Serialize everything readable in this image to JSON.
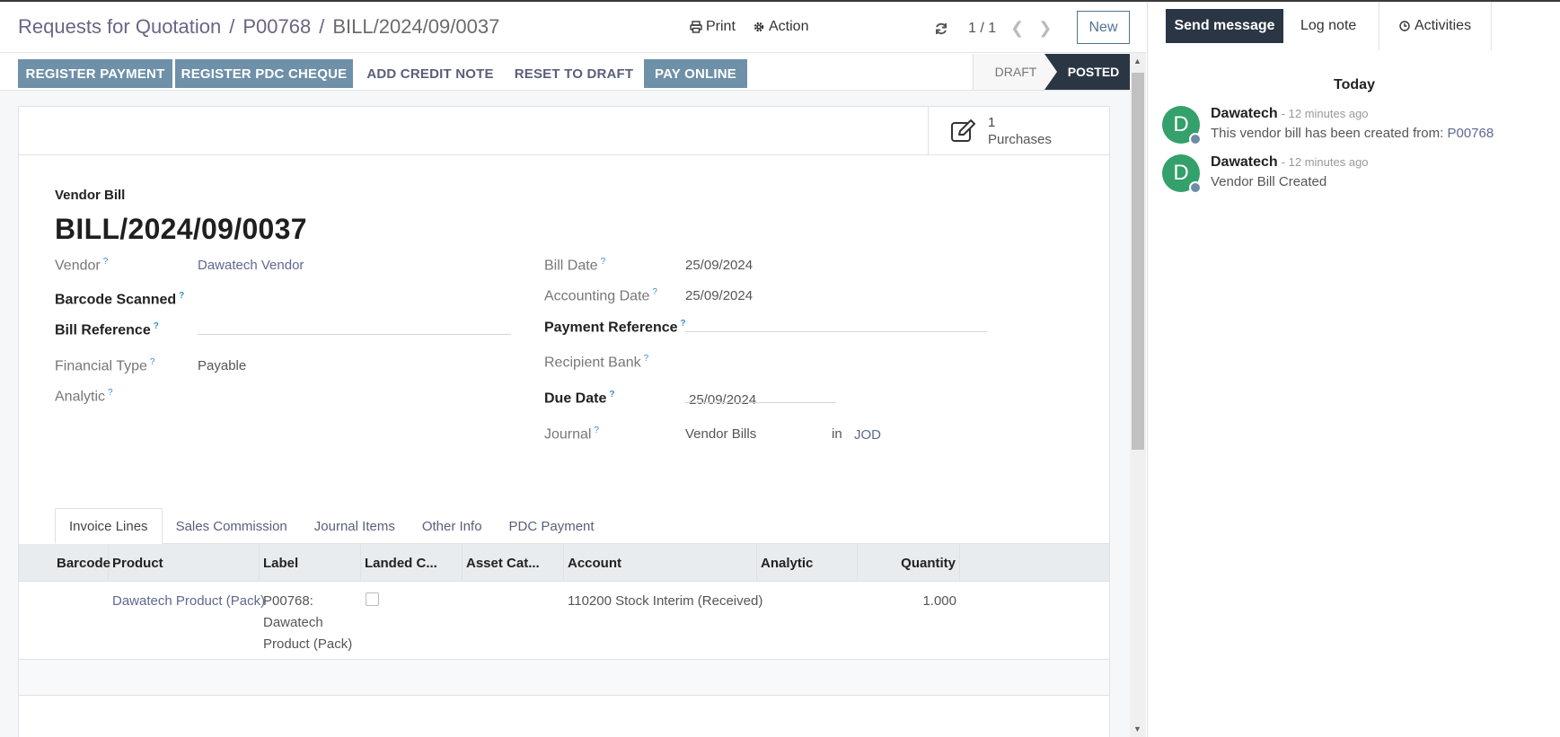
{
  "breadcrumb": {
    "items": [
      "Requests for Quotation",
      "P00768"
    ],
    "current": "BILL/2024/09/0037",
    "separator": "/"
  },
  "control_panel": {
    "print_label": "Print",
    "action_label": "Action",
    "pager_value": "1 / 1",
    "new_label": "New"
  },
  "action_bar": {
    "buttons": [
      {
        "label": "REGISTER PAYMENT",
        "style": "primary"
      },
      {
        "label": "REGISTER PDC CHEQUE",
        "style": "primary"
      },
      {
        "label": "ADD CREDIT NOTE",
        "style": "plain"
      },
      {
        "label": "RESET TO DRAFT",
        "style": "plain"
      },
      {
        "label": "PAY ONLINE",
        "style": "primary"
      }
    ],
    "statuses": [
      {
        "label": "DRAFT",
        "active": false
      },
      {
        "label": "POSTED",
        "active": true
      }
    ]
  },
  "smart_button": {
    "value": "1",
    "label": "Purchases",
    "icon": "edit-icon"
  },
  "document": {
    "type": "Vendor Bill",
    "name": "BILL/2024/09/0037"
  },
  "fields_left": [
    {
      "label": "Vendor",
      "value": "Dawatech Vendor",
      "required": false,
      "link": true
    },
    {
      "label": "Barcode Scanned",
      "value": "",
      "required": true
    },
    {
      "label": "Bill Reference",
      "value": "",
      "required": true
    },
    {
      "label": "Financial Type",
      "value": "Payable",
      "required": false
    },
    {
      "label": "Analytic",
      "value": "",
      "required": false
    }
  ],
  "fields_right": [
    {
      "label": "Bill Date",
      "value": "25/09/2024",
      "required": false
    },
    {
      "label": "Accounting Date",
      "value": "25/09/2024",
      "required": false
    },
    {
      "label": "Payment Reference",
      "value": "",
      "required": true
    },
    {
      "label": "Recipient Bank",
      "value": "",
      "required": false
    },
    {
      "label": "Due Date",
      "value": "25/09/2024",
      "required": true
    },
    {
      "label": "Journal",
      "value": "Vendor Bills",
      "required": false
    }
  ],
  "journal_extra": {
    "in_label": "in",
    "currency": "JOD"
  },
  "help_mark": "?",
  "tabs": [
    {
      "label": "Invoice Lines",
      "active": true
    },
    {
      "label": "Sales Commission",
      "active": false
    },
    {
      "label": "Journal Items",
      "active": false
    },
    {
      "label": "Other Info",
      "active": false
    },
    {
      "label": "PDC Payment",
      "active": false
    }
  ],
  "table": {
    "columns": [
      "Barcode",
      "Product",
      "Label",
      "Landed C...",
      "Asset Cat...",
      "Account",
      "Analytic",
      "Quantity"
    ],
    "rows": [
      {
        "barcode": "",
        "product": "Dawatech Product (Pack)",
        "label_lines": [
          "P00768:",
          "Dawatech",
          "Product (Pack)"
        ],
        "landed_cost": false,
        "asset_category": "",
        "account": "110200 Stock Interim (Received)",
        "analytic": "",
        "quantity": "1.000"
      }
    ]
  },
  "chatter": {
    "send_message": "Send message",
    "log_note": "Log note",
    "activities": "Activities",
    "day_label": "Today",
    "messages": [
      {
        "avatar_letter": "D",
        "author": "Dawatech",
        "time": "- 12 minutes ago",
        "body": "This vendor bill has been created from: ",
        "body_link": "P00768"
      },
      {
        "avatar_letter": "D",
        "author": "Dawatech",
        "time": "- 12 minutes ago",
        "body": "Vendor Bill Created",
        "body_link": ""
      }
    ]
  },
  "colors": {
    "primary_button": "#6e90a8",
    "dark": "#2b3644",
    "link": "#5f6891",
    "avatar": "#34a06b"
  }
}
